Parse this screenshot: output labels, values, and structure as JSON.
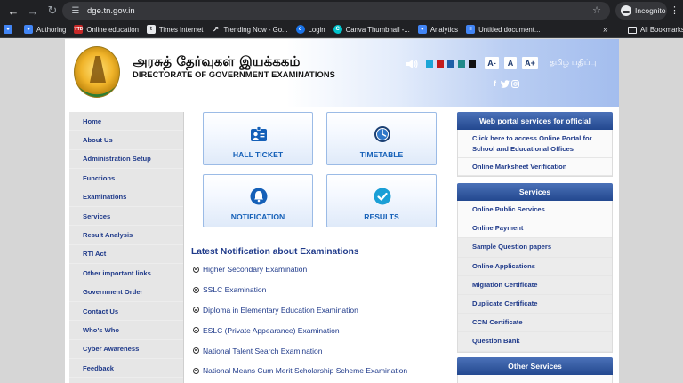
{
  "browser": {
    "url": "dge.tn.gov.in",
    "incognito_label": "Incognito",
    "bookmarks": [
      {
        "label": "",
        "icon": "blue",
        "color": "#4285f4"
      },
      {
        "label": "Authoring",
        "icon": "blue",
        "color": "#4285f4"
      },
      {
        "label": "Online education",
        "icon": "ytd",
        "color": "#c62828"
      },
      {
        "label": "Times Internet",
        "icon": "t",
        "color": "#5f6368"
      },
      {
        "label": "Trending Now - Go...",
        "icon": "trend",
        "color": "#e8eaed"
      },
      {
        "label": "Login",
        "icon": "c",
        "color": "#1a73e8"
      },
      {
        "label": "Canva Thumbnail -...",
        "icon": "canva",
        "color": "#00c4cc"
      },
      {
        "label": "Analytics",
        "icon": "blue",
        "color": "#4285f4"
      },
      {
        "label": "Untitled document...",
        "icon": "doc",
        "color": "#4285f4"
      }
    ],
    "all_bookmarks_label": "All Bookmarks"
  },
  "header": {
    "title_ta": "அரசுத் தேர்வுகள் இயக்ககம்",
    "title_en": "DIRECTORATE OF GOVERNMENT EXAMINATIONS",
    "font_buttons": [
      "A-",
      "A",
      "A+"
    ],
    "language_link": "தமிழ் பதிப்பு",
    "color_swatches": [
      "#1aa5d6",
      "#c21c1c",
      "#1e5fa8",
      "#1f8a8a",
      "#111111",
      "#1b1b1b"
    ],
    "social": [
      "f",
      "t",
      "ig"
    ]
  },
  "leftnav": {
    "items": [
      "Home",
      "About Us",
      "Administration Setup",
      "Functions",
      "Examinations",
      "Services",
      "Result Analysis",
      "RTI Act",
      "Other important links",
      "Government Order",
      "Contact Us",
      "Who's Who",
      "Cyber Awareness",
      "Feedback"
    ]
  },
  "tiles": [
    {
      "label": "HALL TICKET",
      "icon": "id-card-icon"
    },
    {
      "label": "TIMETABLE",
      "icon": "clock-icon"
    },
    {
      "label": "NOTIFICATION",
      "icon": "bell-icon"
    },
    {
      "label": "RESULTS",
      "icon": "check-circle-icon"
    }
  ],
  "latest": {
    "title": "Latest Notification about Examinations",
    "items": [
      "Higher Secondary Examination",
      "SSLC Examination",
      "Diploma in Elementary Education Examination",
      "ESLC (Private Appearance) Examination",
      "National Talent Search Examination",
      "National Means Cum Merit Scholarship Scheme Examination"
    ]
  },
  "portal": {
    "title": "Web portal services for official",
    "items": [
      "Click here to access Online Portal for School and Educational Offices",
      "Online Marksheet Verification"
    ]
  },
  "services": {
    "title": "Services",
    "items": [
      "Online Public Services",
      "Online Payment",
      "Sample Question papers",
      "Online Applications",
      "Migration Certificate",
      "Duplicate Certificate",
      "CCM Certificate",
      "Question Bank"
    ]
  },
  "other_services": {
    "title": "Other Services"
  },
  "colors": {
    "accent": "#23488f",
    "link": "#1f3a8a",
    "tile_label": "#1560b8"
  }
}
